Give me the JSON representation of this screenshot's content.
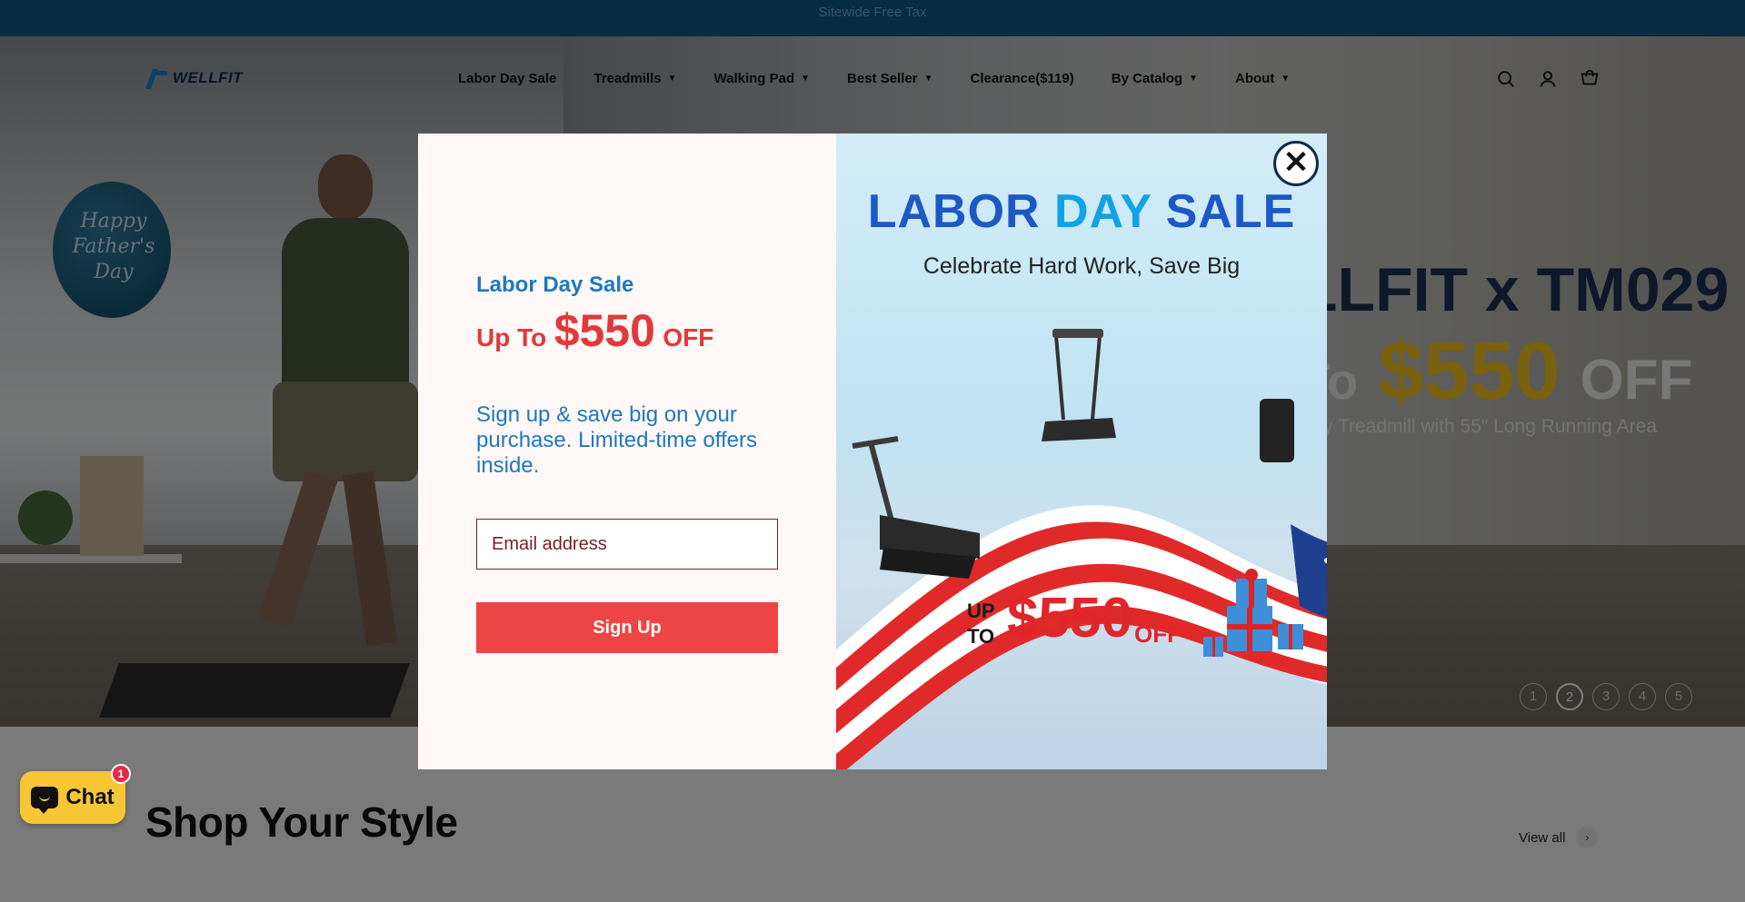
{
  "announcement": {
    "text": "Sitewide Free Tax"
  },
  "header": {
    "logo_text": "WELLFIT",
    "nav": [
      {
        "label": "Labor Day Sale",
        "has_dropdown": false
      },
      {
        "label": "Treadmills",
        "has_dropdown": true
      },
      {
        "label": "Walking Pad",
        "has_dropdown": true
      },
      {
        "label": "Best Seller",
        "has_dropdown": true
      },
      {
        "label": "Clearance($119)",
        "has_dropdown": false
      },
      {
        "label": "By Catalog",
        "has_dropdown": true
      },
      {
        "label": "About",
        "has_dropdown": true
      }
    ],
    "icons": [
      "search-icon",
      "account-icon",
      "cart-icon"
    ]
  },
  "hero": {
    "balloon_text": "Happy Father's Day",
    "headline": "LLFIT x TM029",
    "price_prefix": "To",
    "price_amount": "$550",
    "price_suffix": "OFF",
    "subline": "y Treadmill with 55\" Long Running Area",
    "slides": [
      "1",
      "2",
      "3",
      "4",
      "5"
    ],
    "active_slide": 1
  },
  "section": {
    "title": "Shop Your Style",
    "view_all": "View all"
  },
  "chat": {
    "label": "Chat",
    "badge": "1"
  },
  "popup": {
    "eyebrow": "Labor Day Sale",
    "offer_prefix": "Up To",
    "offer_amount": "$550",
    "offer_suffix": "OFF",
    "description": "Sign up & save big on your purchase. Limited-time offers inside.",
    "email_placeholder": "Email address",
    "button_label": "Sign Up",
    "close_label": "✕",
    "promo": {
      "title_w1": "LABOR",
      "title_w2": "DAY",
      "title_w3": "SALE",
      "subtitle": "Celebrate Hard Work, Save Big",
      "upto_line1": "UP",
      "upto_line2": "TO",
      "amount": "$550",
      "off": "OFF"
    }
  },
  "colors": {
    "announce_bg": "#0d5a84",
    "popup_accent_blue": "#1e78c0",
    "popup_accent_red": "#e1393b",
    "button_red": "#ef4444",
    "chat_yellow": "#f6c634",
    "hero_price_gold": "#f4c21a"
  }
}
